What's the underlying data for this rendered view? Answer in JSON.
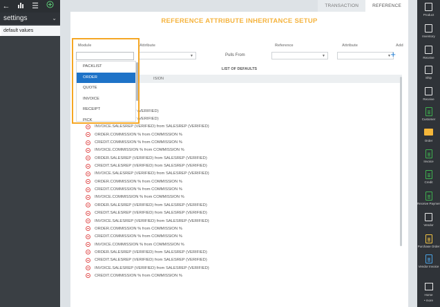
{
  "left": {
    "title": "settings",
    "item": "default values",
    "icons": [
      "back-arrow-icon",
      "bar-chart-icon",
      "list-icon",
      "add-circle-icon"
    ]
  },
  "tabs": [
    {
      "label": "TRANSACTION",
      "active": false
    },
    {
      "label": "REFERENCE",
      "active": true
    }
  ],
  "page": {
    "title": "REFERENCE ATTRIBUTE INHERITANCE SETUP",
    "labels": {
      "module": "Module",
      "attribute1": "Attribute",
      "reference": "Reference",
      "attribute2": "Attribute",
      "add": "Add",
      "pulls_from": "Pulls From"
    },
    "list_title": "LIST OF DEFAULTS",
    "list_header": "ISION"
  },
  "dropdown": {
    "options": [
      "PACKLIST",
      "ORDER",
      "QUOTE",
      "INVOICE",
      "RECEIPT",
      "PICK"
    ],
    "selected": "ORDER"
  },
  "defaults": [
    "from COMMISSION %",
    "from COMMISSION %",
    "from COMMISSION %",
    "FIED) from SALESREP (VERIFIED)",
    "FIED) from SALESREP (VERIFIED)",
    "INVOICE.SALESREP (VERIFIED) from SALESREP (VERIFIED)",
    "ORDER.COMMISSION % from COMMISSION %",
    "CREDIT.COMMISSION % from COMMISSION %",
    "INVOICE.COMMISSION % from COMMISSION %",
    "ORDER.SALESREP (VERIFIED) from SALESREP (VERIFIED)",
    "CREDIT.SALESREP (VERIFIED) from SALESREP (VERIFIED)",
    "INVOICE.SALESREP (VERIFIED) from SALESREP (VERIFIED)",
    "ORDER.COMMISSION % from COMMISSION %",
    "CREDIT.COMMISSION % from COMMISSION %",
    "INVOICE.COMMISSION % from COMMISSION %",
    "ORDER.SALESREP (VERIFIED) from SALESREP (VERIFIED)",
    "CREDIT.SALESREP (VERIFIED) from SALESREP (VERIFIED)",
    "INVOICE.SALESREP (VERIFIED) from SALESREP (VERIFIED)",
    "ORDER.COMMISSION % from COMMISSION %",
    "CREDIT.COMMISSION % from COMMISSION %",
    "INVOICE.COMMISSION % from COMMISSION %",
    "ORDER.SALESREP (VERIFIED) from SALESREP (VERIFIED)",
    "CREDIT.SALESREP (VERIFIED) from SALESREP (VERIFIED)",
    "INVOICE.SALESREP (VERIFIED) from SALESREP (VERIFIED)",
    "CREDIT.COMMISSION % from COMMISSION %"
  ],
  "right_nav": [
    {
      "label": "Product"
    },
    {
      "label": "Inventory"
    },
    {
      "label": "Receive"
    },
    {
      "label": "Ship"
    },
    {
      "label": "Receive"
    },
    {
      "label": "Customer"
    },
    {
      "label": "Order"
    },
    {
      "label": "Invoice"
    },
    {
      "label": "Credit"
    },
    {
      "label": "Receive Payment"
    },
    {
      "label": "Vendor"
    },
    {
      "label": "Purchase Order"
    },
    {
      "label": "Vendor Invoice"
    },
    {
      "label": "Home"
    }
  ],
  "right_more": "• more",
  "colors": {
    "accent": "#f5b33d",
    "highlight_outline": "#f5a623",
    "selected": "#1e73c8",
    "remove": "#e15252",
    "add": "#1a7bd6"
  }
}
